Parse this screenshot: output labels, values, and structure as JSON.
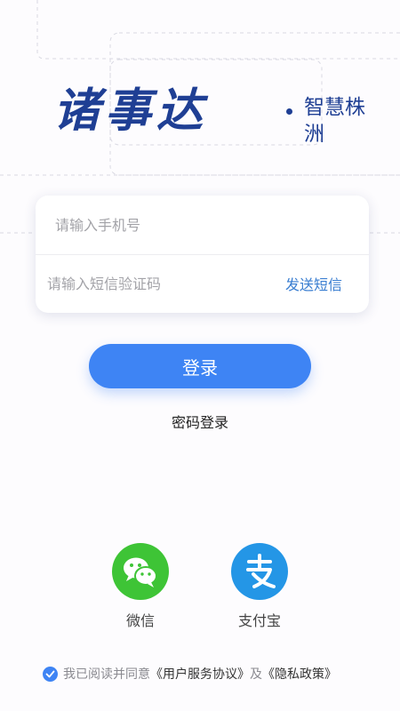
{
  "logo": {
    "main": "诸事达",
    "sub": "智慧株洲"
  },
  "form": {
    "phone_placeholder": "请输入手机号",
    "code_placeholder": "请输入短信验证码",
    "send_sms_label": "发送短信"
  },
  "login_button": "登录",
  "password_login": "密码登录",
  "social": [
    {
      "label": "微信",
      "icon": "wechat-icon"
    },
    {
      "label": "支付宝",
      "icon": "alipay-icon"
    }
  ],
  "agreement": {
    "prefix": "我已阅读并同意",
    "user_agreement": "《用户服务协议》",
    "conjunction": "及",
    "privacy_policy": "《隐私政策》"
  },
  "colors": {
    "primary": "#3e84f4",
    "logo": "#1f3f94",
    "link": "#3a7ed1",
    "wechat": "#3ec436",
    "alipay": "#2496e6"
  }
}
